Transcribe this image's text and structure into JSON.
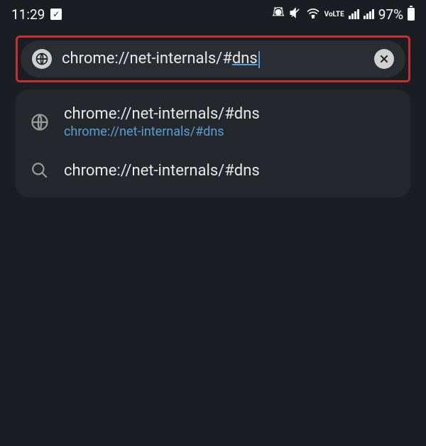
{
  "status_bar": {
    "time": "11:29",
    "battery_percent": "97%"
  },
  "address_bar": {
    "text_prefix": "chrome://net-internals/#",
    "text_underlined": "dns"
  },
  "suggestions": {
    "item_1": {
      "title": "chrome://net-internals/#dns",
      "url": "chrome://net-internals/#dns"
    },
    "item_2": {
      "title": "chrome://net-internals/#dns"
    }
  }
}
